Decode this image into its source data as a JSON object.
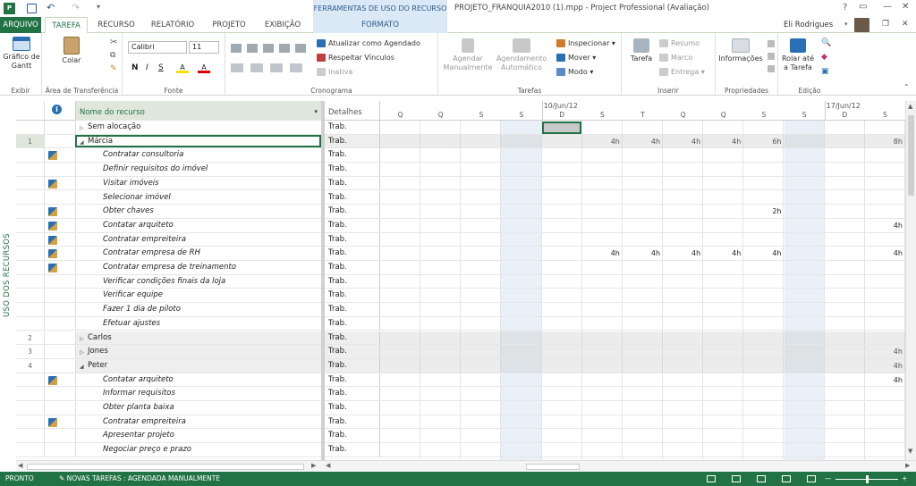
{
  "titlebar": {
    "context_label": "FERRAMENTAS DE USO DO RECURSO",
    "title": "PROJETO_FRANQUIA2010 (1).mpp - Project Professional (Avaliação)",
    "help": "?",
    "user": "Eli Rodrigues"
  },
  "tabs": [
    "ARQUIVO",
    "TAREFA",
    "RECURSO",
    "RELATÓRIO",
    "PROJETO",
    "EXIBIÇÃO",
    "FORMATO"
  ],
  "ribbon": {
    "gantt_label": "Gráfico de Gantt",
    "paste_label": "Colar",
    "font_name": "Calibri",
    "font_size": "11",
    "update_schedule": "Atualizar como Agendado",
    "respect_links": "Respeitar Vínculos",
    "inactive": "Inativa",
    "manual_schedule": "Agendar Manualmente",
    "auto_schedule": "Agendamento Automático",
    "inspect": "Inspecionar",
    "move": "Mover",
    "mode": "Modo",
    "task": "Tarefa",
    "summary": "Resumo",
    "milestone": "Marco",
    "deliverable": "Entrega",
    "info": "Informações",
    "scroll_to_task": "Rolar até a Tarefa",
    "groups": [
      "Exibir",
      "Área de Transferência",
      "Fonte",
      "Cronograma",
      "Tarefas",
      "Inserir",
      "Propriedades",
      "Edição"
    ]
  },
  "side_label": "USO DOS RECURSOS",
  "grid": {
    "col_name": "Nome do recurso",
    "col_details": "Detalhes",
    "rows": [
      {
        "num": "",
        "icon": false,
        "name": "Sem alocação",
        "level": 0,
        "expander": "▷",
        "summary": false,
        "details": "Trab."
      },
      {
        "num": "1",
        "icon": false,
        "name": "Márcia",
        "level": 0,
        "expander": "◢",
        "summary": true,
        "details": "Trab."
      },
      {
        "num": "",
        "icon": true,
        "name": "Contratar consultoria",
        "level": 1,
        "summary": false,
        "details": "Trab."
      },
      {
        "num": "",
        "icon": false,
        "name": "Definir requisitos do imóvel",
        "level": 1,
        "summary": false,
        "details": "Trab."
      },
      {
        "num": "",
        "icon": true,
        "name": "Visitar imóveis",
        "level": 1,
        "summary": false,
        "details": "Trab."
      },
      {
        "num": "",
        "icon": false,
        "name": "Selecionar imóvel",
        "level": 1,
        "summary": false,
        "details": "Trab."
      },
      {
        "num": "",
        "icon": true,
        "name": "Obter chaves",
        "level": 1,
        "summary": false,
        "details": "Trab."
      },
      {
        "num": "",
        "icon": true,
        "name": "Contatar arquiteto",
        "level": 1,
        "summary": false,
        "details": "Trab."
      },
      {
        "num": "",
        "icon": true,
        "name": "Contratar empreiteira",
        "level": 1,
        "summary": false,
        "details": "Trab."
      },
      {
        "num": "",
        "icon": true,
        "name": "Contratar empresa de RH",
        "level": 1,
        "summary": false,
        "details": "Trab."
      },
      {
        "num": "",
        "icon": true,
        "name": "Contratar empresa de treinamento",
        "level": 1,
        "summary": false,
        "details": "Trab."
      },
      {
        "num": "",
        "icon": false,
        "name": "Verificar condições finais da loja",
        "level": 1,
        "summary": false,
        "details": "Trab."
      },
      {
        "num": "",
        "icon": false,
        "name": "Verificar equipe",
        "level": 1,
        "summary": false,
        "details": "Trab."
      },
      {
        "num": "",
        "icon": false,
        "name": "Fazer 1 dia de piloto",
        "level": 1,
        "summary": false,
        "details": "Trab."
      },
      {
        "num": "",
        "icon": false,
        "name": "Efetuar ajustes",
        "level": 1,
        "summary": false,
        "details": "Trab."
      },
      {
        "num": "2",
        "icon": false,
        "name": "Carlos",
        "level": 0,
        "expander": "▷",
        "summary": true,
        "details": "Trab."
      },
      {
        "num": "3",
        "icon": false,
        "name": "Jones",
        "level": 0,
        "expander": "▷",
        "summary": true,
        "details": "Trab."
      },
      {
        "num": "4",
        "icon": false,
        "name": "Peter",
        "level": 0,
        "expander": "◢",
        "summary": true,
        "details": "Trab."
      },
      {
        "num": "",
        "icon": true,
        "name": "Contatar arquiteto",
        "level": 1,
        "summary": false,
        "details": "Trab."
      },
      {
        "num": "",
        "icon": false,
        "name": "Informar requisitos",
        "level": 1,
        "summary": false,
        "details": "Trab."
      },
      {
        "num": "",
        "icon": false,
        "name": "Obter planta baixa",
        "level": 1,
        "summary": false,
        "details": "Trab."
      },
      {
        "num": "",
        "icon": true,
        "name": "Contratar empreiteira",
        "level": 1,
        "summary": false,
        "details": "Trab."
      },
      {
        "num": "",
        "icon": false,
        "name": "Apresentar projeto",
        "level": 1,
        "summary": false,
        "details": "Trab."
      },
      {
        "num": "",
        "icon": false,
        "name": "Negociar preço e prazo",
        "level": 1,
        "summary": false,
        "details": "Trab."
      }
    ]
  },
  "timeline": {
    "weeks": [
      "10/Jun/12",
      "17/Jun/12"
    ],
    "days": [
      "Q",
      "Q",
      "S",
      "S",
      "D",
      "S",
      "T",
      "Q",
      "Q",
      "S",
      "S",
      "D",
      "S"
    ],
    "values": [
      [
        "",
        "",
        "",
        "",
        "",
        "",
        "",
        "",
        "",
        "",
        "",
        "",
        ""
      ],
      [
        "",
        "",
        "",
        "",
        "",
        "4h",
        "4h",
        "4h",
        "4h",
        "6h",
        "",
        "",
        "8h"
      ],
      [
        "",
        "",
        "",
        "",
        "",
        "",
        "",
        "",
        "",
        "",
        "",
        "",
        ""
      ],
      [
        "",
        "",
        "",
        "",
        "",
        "",
        "",
        "",
        "",
        "",
        "",
        "",
        ""
      ],
      [
        "",
        "",
        "",
        "",
        "",
        "",
        "",
        "",
        "",
        "",
        "",
        "",
        ""
      ],
      [
        "",
        "",
        "",
        "",
        "",
        "",
        "",
        "",
        "",
        "",
        "",
        "",
        ""
      ],
      [
        "",
        "",
        "",
        "",
        "",
        "",
        "",
        "",
        "",
        "2h",
        "",
        "",
        ""
      ],
      [
        "",
        "",
        "",
        "",
        "",
        "",
        "",
        "",
        "",
        "",
        "",
        "",
        "4h"
      ],
      [
        "",
        "",
        "",
        "",
        "",
        "",
        "",
        "",
        "",
        "",
        "",
        "",
        ""
      ],
      [
        "",
        "",
        "",
        "",
        "",
        "4h",
        "4h",
        "4h",
        "4h",
        "4h",
        "",
        "",
        "4h"
      ],
      [
        "",
        "",
        "",
        "",
        "",
        "",
        "",
        "",
        "",
        "",
        "",
        "",
        ""
      ],
      [
        "",
        "",
        "",
        "",
        "",
        "",
        "",
        "",
        "",
        "",
        "",
        "",
        ""
      ],
      [
        "",
        "",
        "",
        "",
        "",
        "",
        "",
        "",
        "",
        "",
        "",
        "",
        ""
      ],
      [
        "",
        "",
        "",
        "",
        "",
        "",
        "",
        "",
        "",
        "",
        "",
        "",
        ""
      ],
      [
        "",
        "",
        "",
        "",
        "",
        "",
        "",
        "",
        "",
        "",
        "",
        "",
        ""
      ],
      [
        "",
        "",
        "",
        "",
        "",
        "",
        "",
        "",
        "",
        "",
        "",
        "",
        ""
      ],
      [
        "",
        "",
        "",
        "",
        "",
        "",
        "",
        "",
        "",
        "",
        "",
        "",
        "4h"
      ],
      [
        "",
        "",
        "",
        "",
        "",
        "",
        "",
        "",
        "",
        "",
        "",
        "",
        "4h"
      ],
      [
        "",
        "",
        "",
        "",
        "",
        "",
        "",
        "",
        "",
        "",
        "",
        "",
        "4h"
      ],
      [
        "",
        "",
        "",
        "",
        "",
        "",
        "",
        "",
        "",
        "",
        "",
        "",
        ""
      ],
      [
        "",
        "",
        "",
        "",
        "",
        "",
        "",
        "",
        "",
        "",
        "",
        "",
        ""
      ],
      [
        "",
        "",
        "",
        "",
        "",
        "",
        "",
        "",
        "",
        "",
        "",
        "",
        ""
      ],
      [
        "",
        "",
        "",
        "",
        "",
        "",
        "",
        "",
        "",
        "",
        "",
        "",
        ""
      ],
      [
        "",
        "",
        "",
        "",
        "",
        "",
        "",
        "",
        "",
        "",
        "",
        "",
        ""
      ]
    ]
  },
  "status": {
    "ready": "PRONTO",
    "new_tasks": "NOVAS TAREFAS : AGENDADA MANUALMENTE"
  },
  "colors": {
    "accent": "#217346",
    "weekend": "#e9f0f8"
  }
}
